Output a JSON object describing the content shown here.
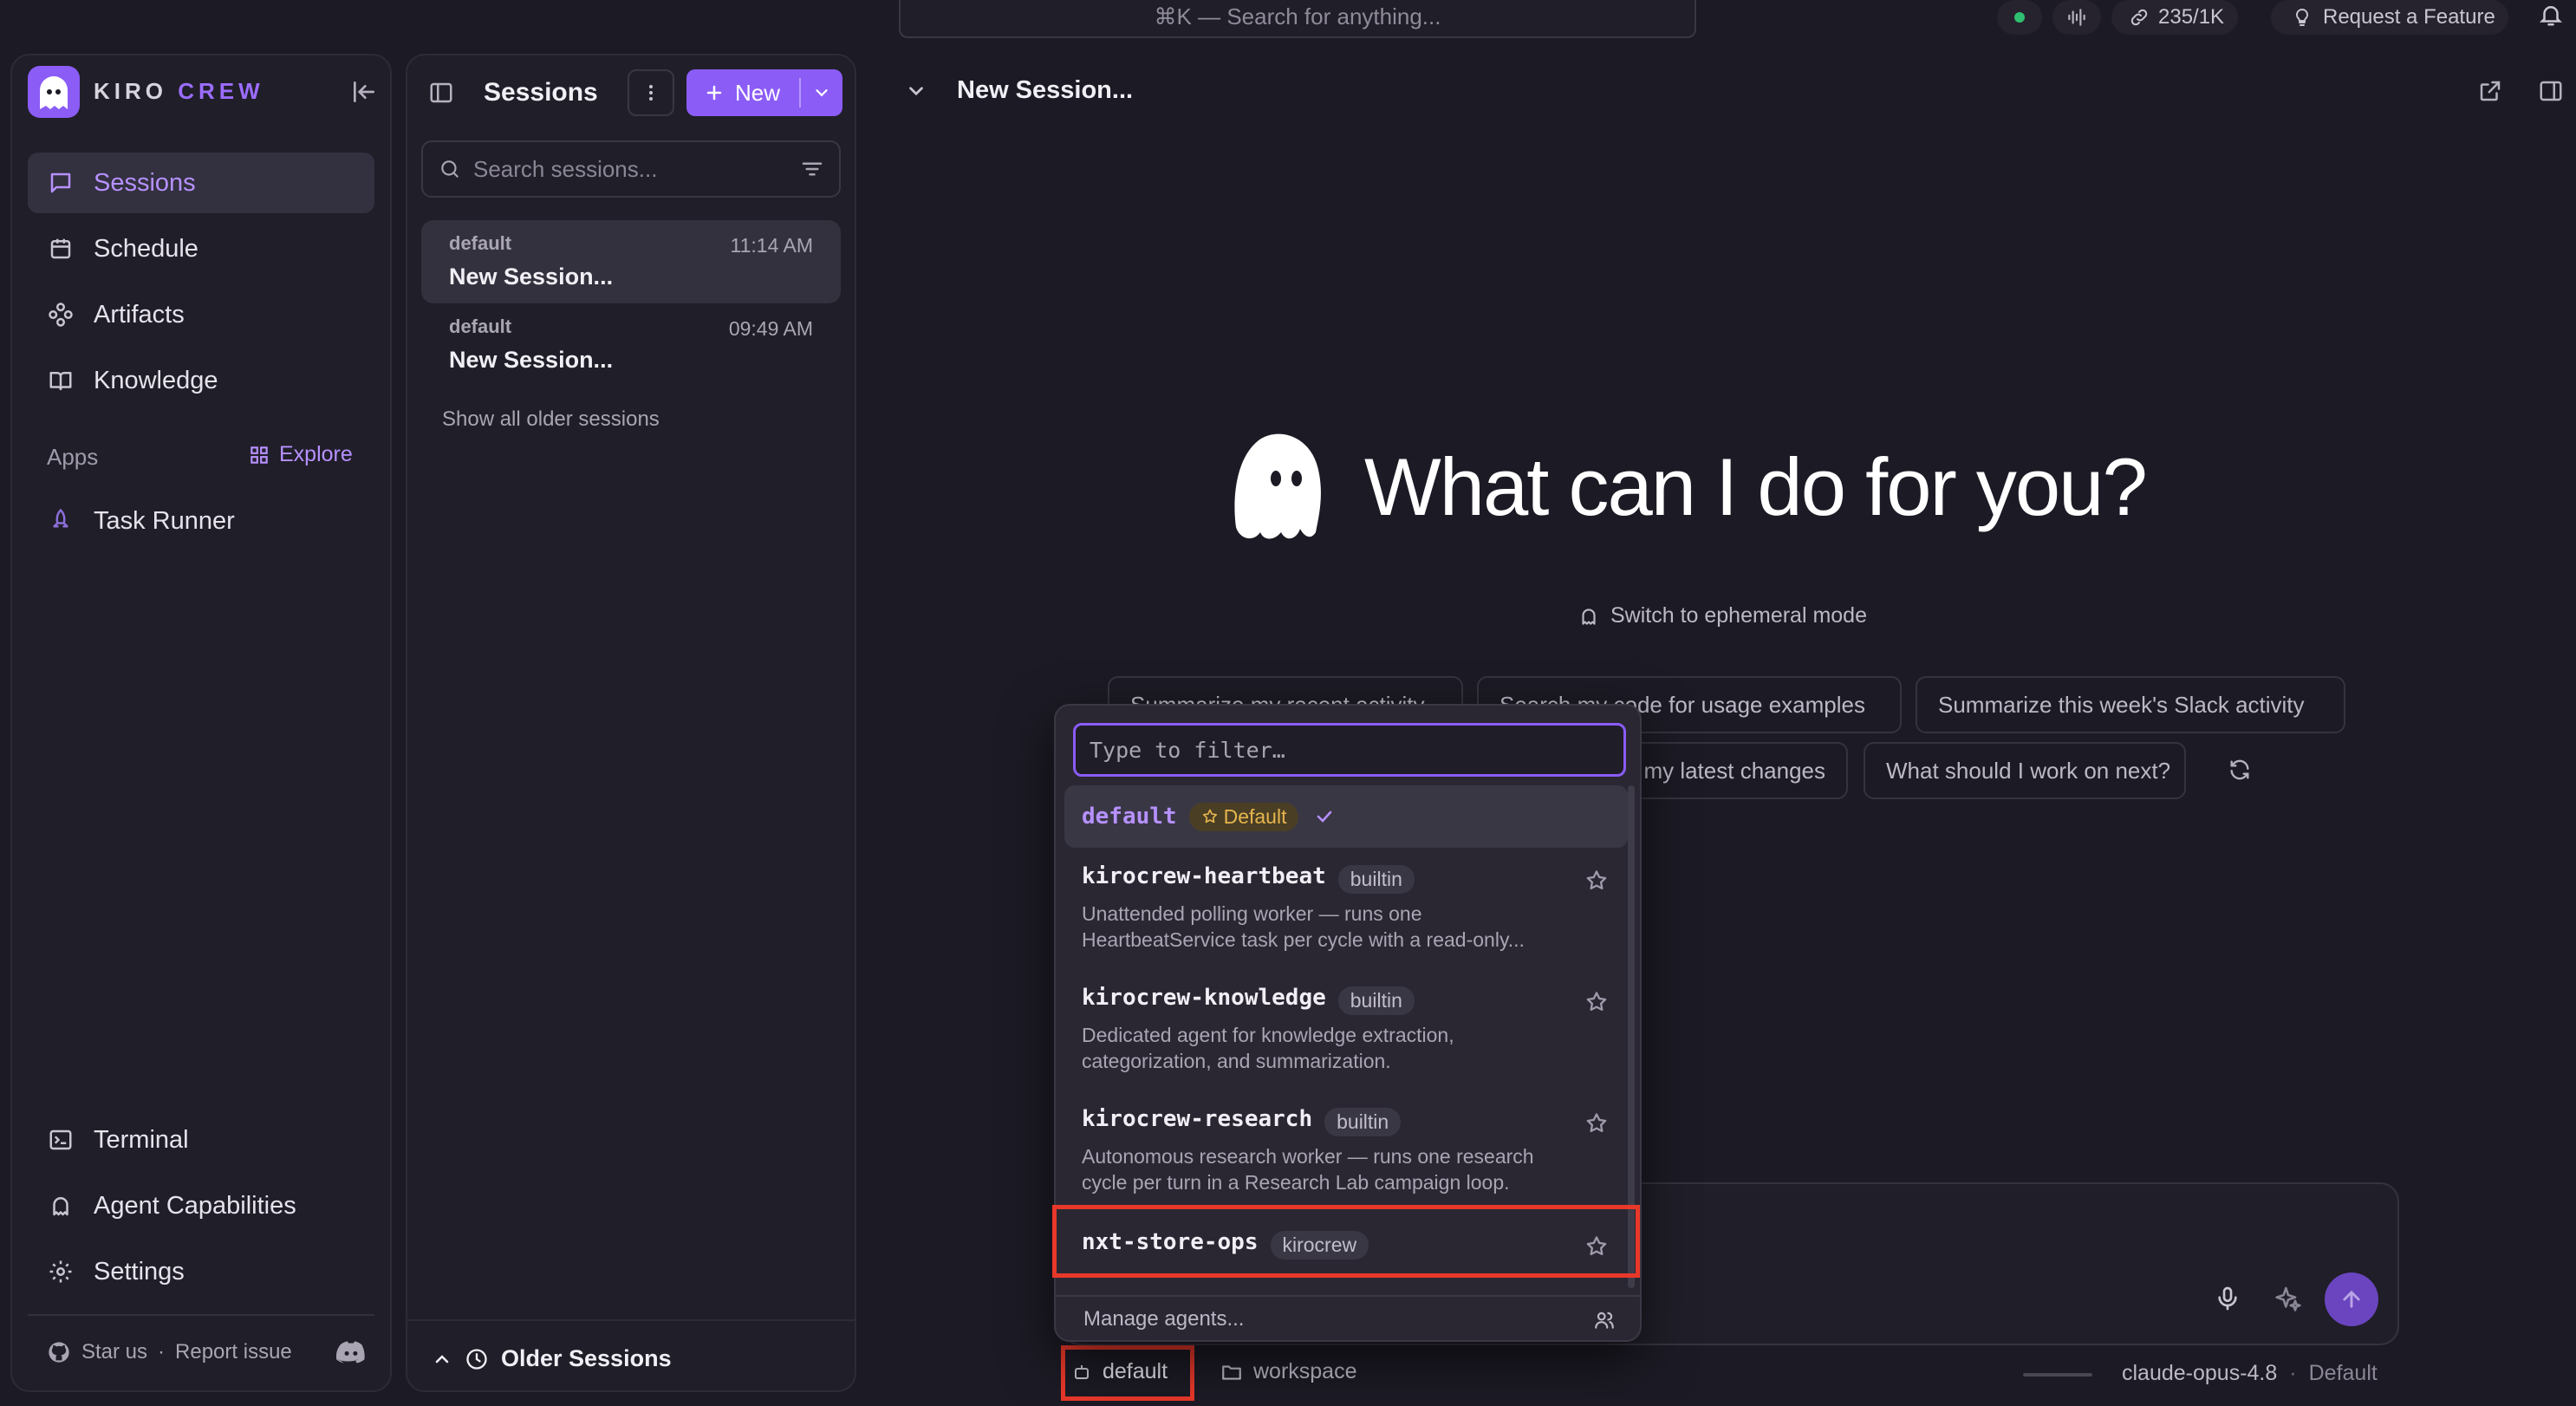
{
  "topbar": {
    "search_placeholder": "⌘K — Search for anything...",
    "usage": "235/1K",
    "request_feature": "Request a Feature"
  },
  "sidebar": {
    "brand_a": "KIRO",
    "brand_b": "CREW",
    "nav": [
      {
        "label": "Sessions",
        "icon": "chat-icon",
        "active": true
      },
      {
        "label": "Schedule",
        "icon": "calendar-icon"
      },
      {
        "label": "Artifacts",
        "icon": "artifacts-icon"
      },
      {
        "label": "Knowledge",
        "icon": "book-icon"
      }
    ],
    "apps_label": "Apps",
    "explore_label": "Explore",
    "apps": [
      {
        "label": "Task Runner",
        "icon": "rocket-icon"
      }
    ],
    "bottom": [
      {
        "label": "Terminal",
        "icon": "terminal-icon"
      },
      {
        "label": "Agent Capabilities",
        "icon": "ghost-icon"
      },
      {
        "label": "Settings",
        "icon": "gear-icon"
      }
    ],
    "star_us": "Star us",
    "dot": "·",
    "report_issue": "Report issue"
  },
  "sessions_panel": {
    "title": "Sessions",
    "new_label": "New",
    "search_placeholder": "Search sessions...",
    "items": [
      {
        "agent": "default",
        "title": "New Session...",
        "time": "11:14 AM",
        "selected": true
      },
      {
        "agent": "default",
        "title": "New Session...",
        "time": "09:49 AM",
        "selected": false
      }
    ],
    "show_older": "Show all older sessions",
    "older_sessions": "Older Sessions"
  },
  "main": {
    "session_title": "New Session...",
    "hero": "What can I do for you?",
    "ephemeral": "Switch to ephemeral mode",
    "suggestions_row1": [
      "Summarize my recent activity",
      "Search my code for usage examples",
      "Summarize this week's Slack activity"
    ],
    "suggestions_row2": [
      "Review my latest changes",
      "What should I work on next?"
    ],
    "footer": {
      "agent": "default",
      "workspace": "workspace",
      "model": "claude-opus-4.8",
      "dot": "·",
      "mode": "Default"
    }
  },
  "dropdown": {
    "filter_placeholder": "Type to filter…",
    "default_agent": {
      "name": "default",
      "badge": "Default"
    },
    "agents": [
      {
        "name": "kirocrew-heartbeat",
        "badge": "builtin",
        "desc1": "Unattended polling worker — runs one",
        "desc2": "HeartbeatService task per cycle with a read-only..."
      },
      {
        "name": "kirocrew-knowledge",
        "badge": "builtin",
        "desc1": "Dedicated agent for knowledge extraction,",
        "desc2": "categorization, and summarization."
      },
      {
        "name": "kirocrew-research",
        "badge": "builtin",
        "desc1": "Autonomous research worker — runs one research",
        "desc2": "cycle per turn in a Research Lab campaign loop."
      },
      {
        "name": "nxt-store-ops",
        "badge": "kirocrew",
        "desc1": "",
        "desc2": ""
      }
    ],
    "manage": "Manage agents..."
  },
  "colors": {
    "accent": "#8b5cf6",
    "accent_text": "#b691ff",
    "highlight": "#e8382a"
  }
}
